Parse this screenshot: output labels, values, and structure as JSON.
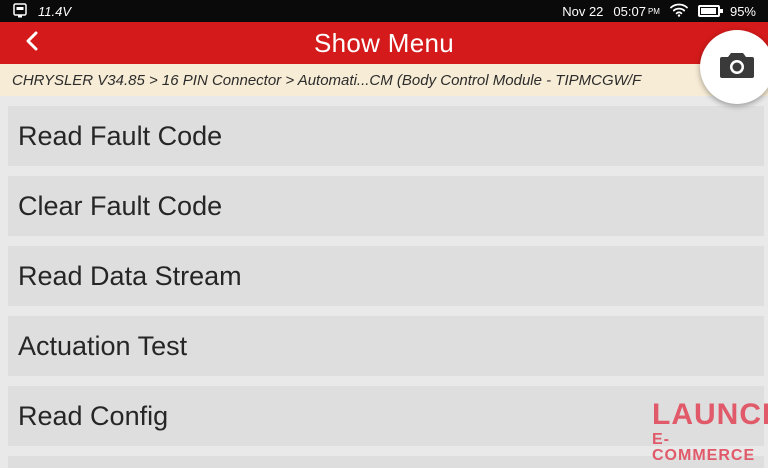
{
  "status_bar": {
    "voltage": "11.4V",
    "date": "Nov 22",
    "time": "05:07",
    "ampm": "PM",
    "battery": "95%",
    "battery_level": 0.95,
    "icons": [
      "obd-connector-icon",
      "wifi-icon",
      "battery-icon"
    ]
  },
  "header": {
    "title": "Show Menu",
    "back_icon": "chevron-left-icon"
  },
  "breadcrumb": {
    "path": "CHRYSLER V34.85 > 16 PIN Connector > Automati...CM (Body Control Module - TIPMCGW/F"
  },
  "menu": {
    "items": [
      {
        "label": "Read Fault Code"
      },
      {
        "label": "Clear Fault Code"
      },
      {
        "label": "Read Data Stream"
      },
      {
        "label": "Actuation Test"
      },
      {
        "label": "Read Config"
      }
    ]
  },
  "camera_button": {
    "icon": "camera-icon"
  },
  "watermark": {
    "line1": "LAUNCH",
    "line2": "E-COMMERCE"
  },
  "colors": {
    "header_red": "#d41a1a",
    "breadcrumb_bg": "#f7ecd6",
    "menu_item_bg": "#dedede",
    "watermark": "#e05a6a"
  }
}
